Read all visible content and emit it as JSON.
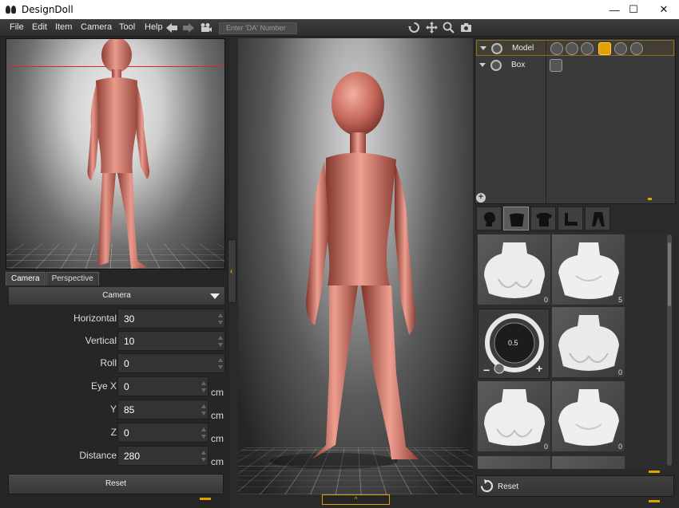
{
  "window": {
    "title": "DesignDoll",
    "controls": {
      "minimize": "—",
      "maximize": "☐",
      "close": "✕"
    }
  },
  "menu": {
    "items": [
      "File",
      "Edit",
      "Item",
      "Camera",
      "Tool",
      "Help"
    ],
    "da_placeholder": "Enter 'DA' Number"
  },
  "camera_panel": {
    "tabs": [
      "Camera",
      "Perspective"
    ],
    "dropdown_value": "Camera",
    "params": [
      {
        "label": "Horizontal",
        "value": "30",
        "unit": ""
      },
      {
        "label": "Vertical",
        "value": "10",
        "unit": ""
      },
      {
        "label": "Roll",
        "value": "0",
        "unit": ""
      },
      {
        "label": "Eye X",
        "value": "0",
        "unit": "cm"
      },
      {
        "label": "Y",
        "value": "85",
        "unit": "cm"
      },
      {
        "label": "Z",
        "value": "0",
        "unit": "cm"
      },
      {
        "label": "Distance",
        "value": "280",
        "unit": "cm"
      }
    ],
    "reset_label": "Reset"
  },
  "scene_tree": {
    "items": [
      {
        "label": "Model",
        "selected": true
      },
      {
        "label": "Box",
        "selected": false
      }
    ]
  },
  "item_panel": {
    "tiles": [
      {
        "count": "0"
      },
      {
        "count": "5"
      },
      {
        "count": "0"
      },
      {
        "count": "0"
      },
      {
        "count": "0"
      }
    ],
    "slider": {
      "value": "0.5",
      "minus": "−",
      "plus": "+"
    },
    "reset_label": "Reset"
  },
  "colors": {
    "accent": "#e0a000",
    "skin": "#c4675a",
    "panel": "#2a2a2a"
  }
}
